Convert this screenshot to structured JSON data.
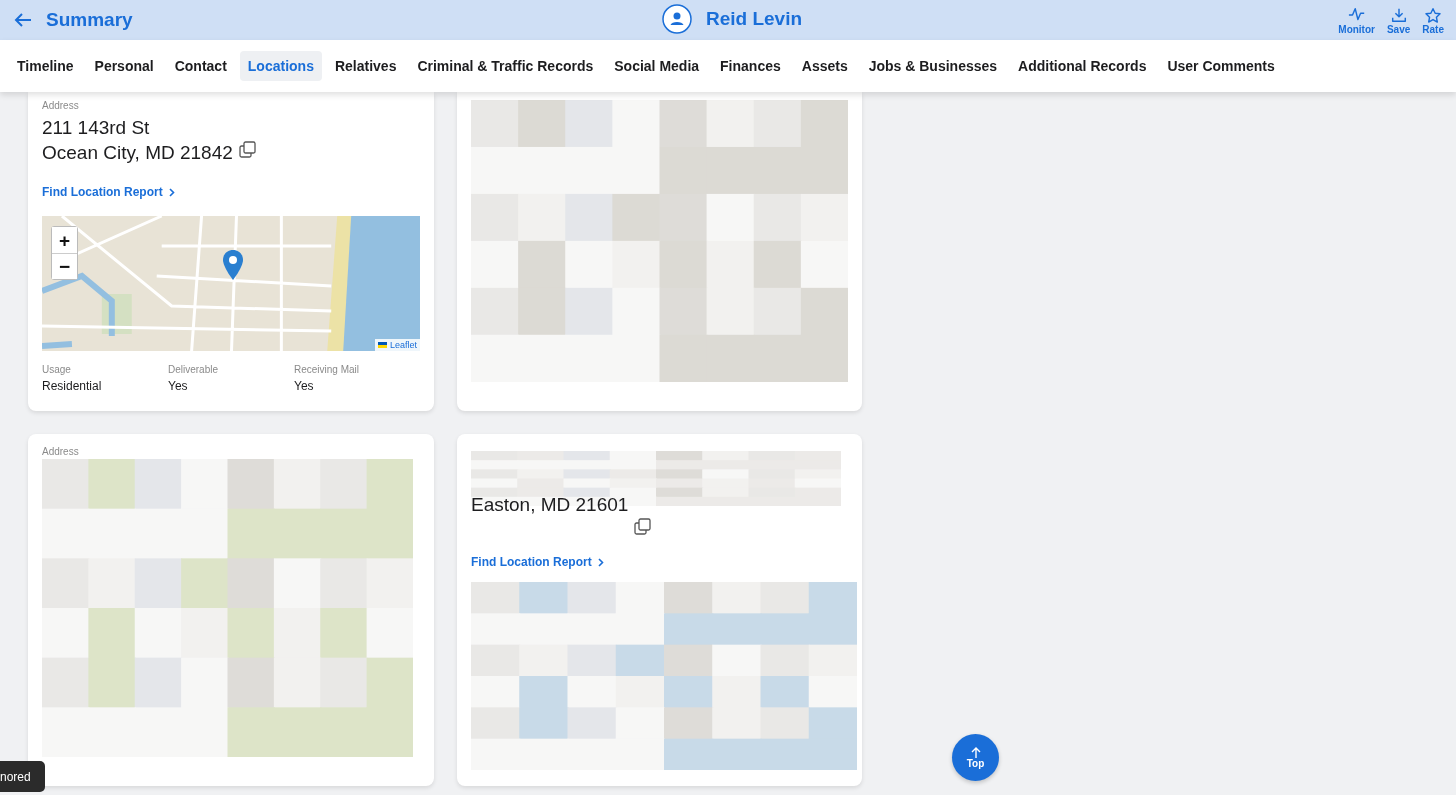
{
  "header": {
    "title": "Summary",
    "person_name": "Reid Levin",
    "actions": [
      {
        "label": "Monitor"
      },
      {
        "label": "Save"
      },
      {
        "label": "Rate"
      }
    ]
  },
  "tabs": [
    {
      "label": "Timeline",
      "selected": false
    },
    {
      "label": "Personal",
      "selected": false
    },
    {
      "label": "Contact",
      "selected": false
    },
    {
      "label": "Locations",
      "selected": true
    },
    {
      "label": "Relatives",
      "selected": false
    },
    {
      "label": "Criminal & Traffic Records",
      "selected": false
    },
    {
      "label": "Social Media",
      "selected": false
    },
    {
      "label": "Finances",
      "selected": false
    },
    {
      "label": "Assets",
      "selected": false
    },
    {
      "label": "Jobs & Businesses",
      "selected": false
    },
    {
      "label": "Additional Records",
      "selected": false
    },
    {
      "label": "User Comments",
      "selected": false
    }
  ],
  "cards": [
    {
      "kind": "address",
      "label": "Address",
      "lines": [
        "211 143rd St",
        "Ocean City, MD 21842"
      ],
      "link": "Find Location Report",
      "map": {
        "zoom_in": "+",
        "zoom_out": "−",
        "attribution": "Leaflet"
      },
      "fields": [
        {
          "label": "Usage",
          "value": "Residential"
        },
        {
          "label": "Deliverable",
          "value": "Yes"
        },
        {
          "label": "Receiving Mail",
          "value": "Yes"
        }
      ]
    },
    {
      "kind": "blurred"
    },
    {
      "kind": "label_blurred",
      "label": "Address"
    },
    {
      "kind": "partial",
      "lines": [
        "Easton, MD 21601"
      ],
      "link": "Find Location Report"
    }
  ],
  "toast": {
    "text": "nored"
  },
  "top_button": {
    "label": "Top"
  }
}
